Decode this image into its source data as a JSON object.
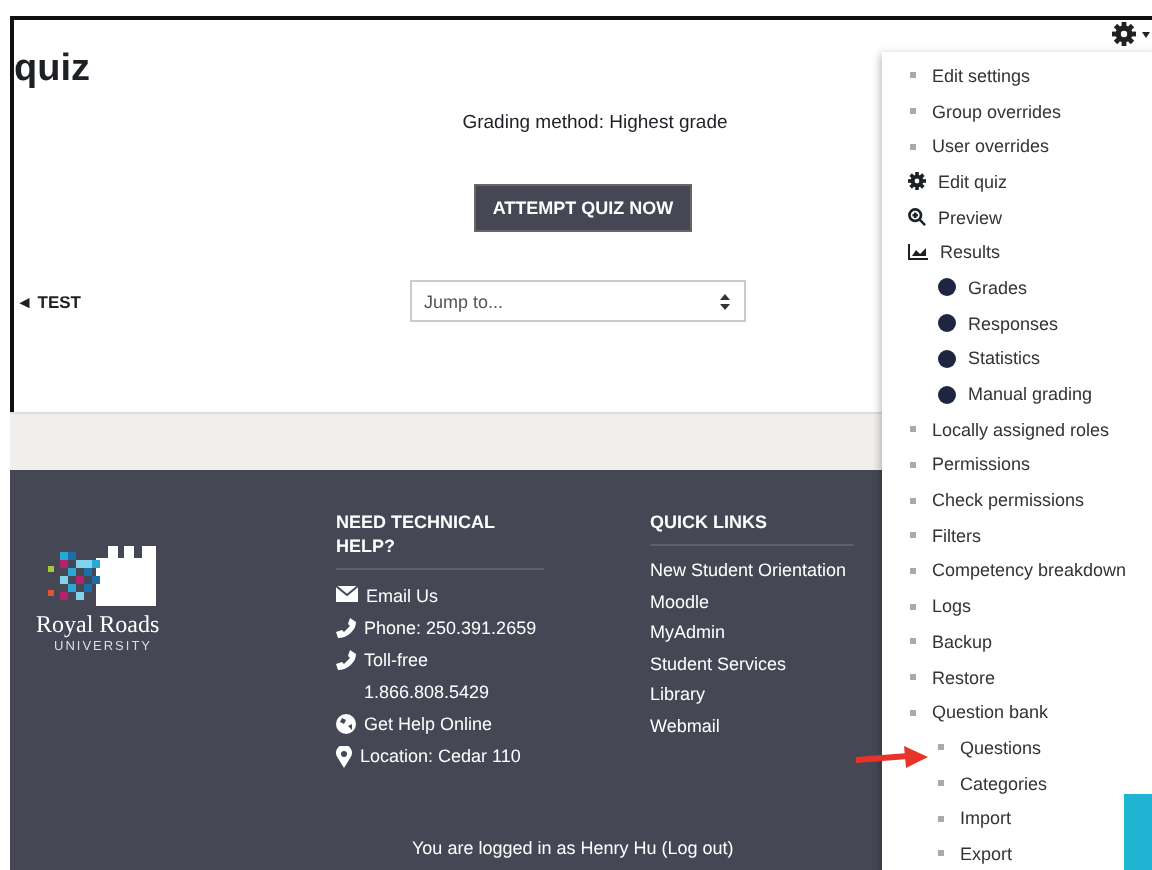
{
  "page": {
    "title": "quiz",
    "grading_method": "Grading method: Highest grade",
    "attempt_button": "ATTEMPT QUIZ NOW",
    "prev_link": "◄ TEST",
    "jump_select": {
      "placeholder": "Jump to..."
    }
  },
  "footer": {
    "logo": {
      "name": "Royal Roads",
      "subtitle": "UNIVERSITY"
    },
    "help": {
      "heading": "NEED TECHNICAL HELP?",
      "items": [
        {
          "kind": "email",
          "text": "Email Us"
        },
        {
          "kind": "phone",
          "text": "Phone: 250.391.2659"
        },
        {
          "kind": "phone",
          "text": "Toll-free 1.866.808.5429"
        },
        {
          "kind": "globe",
          "text": "Get Help Online"
        },
        {
          "kind": "pin",
          "text": "Location: Cedar 110"
        }
      ]
    },
    "quick_links": {
      "heading": "QUICK LINKS",
      "items": [
        "New Student Orientation",
        "Moodle",
        "MyAdmin",
        "Student Services",
        "Library",
        "Webmail"
      ]
    },
    "login_text": "You are logged in as Henry Hu (Log out)"
  },
  "menu": {
    "items": [
      {
        "kind": "bullet",
        "label": "Edit settings"
      },
      {
        "kind": "bullet",
        "label": "Group overrides"
      },
      {
        "kind": "bullet",
        "label": "User overrides"
      },
      {
        "kind": "gear",
        "label": "Edit quiz"
      },
      {
        "kind": "preview",
        "label": "Preview"
      },
      {
        "kind": "chart",
        "label": "Results",
        "children": [
          {
            "kind": "dot",
            "label": "Grades"
          },
          {
            "kind": "dot",
            "label": "Responses"
          },
          {
            "kind": "dot",
            "label": "Statistics"
          },
          {
            "kind": "dot",
            "label": "Manual grading"
          }
        ]
      },
      {
        "kind": "bullet",
        "label": "Locally assigned roles"
      },
      {
        "kind": "bullet",
        "label": "Permissions"
      },
      {
        "kind": "bullet",
        "label": "Check permissions"
      },
      {
        "kind": "bullet",
        "label": "Filters"
      },
      {
        "kind": "bullet",
        "label": "Competency breakdown"
      },
      {
        "kind": "bullet",
        "label": "Logs"
      },
      {
        "kind": "bullet",
        "label": "Backup"
      },
      {
        "kind": "bullet",
        "label": "Restore"
      },
      {
        "kind": "bullet",
        "label": "Question bank",
        "children": [
          {
            "kind": "bullet",
            "label": "Questions"
          },
          {
            "kind": "bullet",
            "label": "Categories"
          },
          {
            "kind": "bullet",
            "label": "Import"
          },
          {
            "kind": "bullet",
            "label": "Export"
          }
        ]
      }
    ]
  }
}
